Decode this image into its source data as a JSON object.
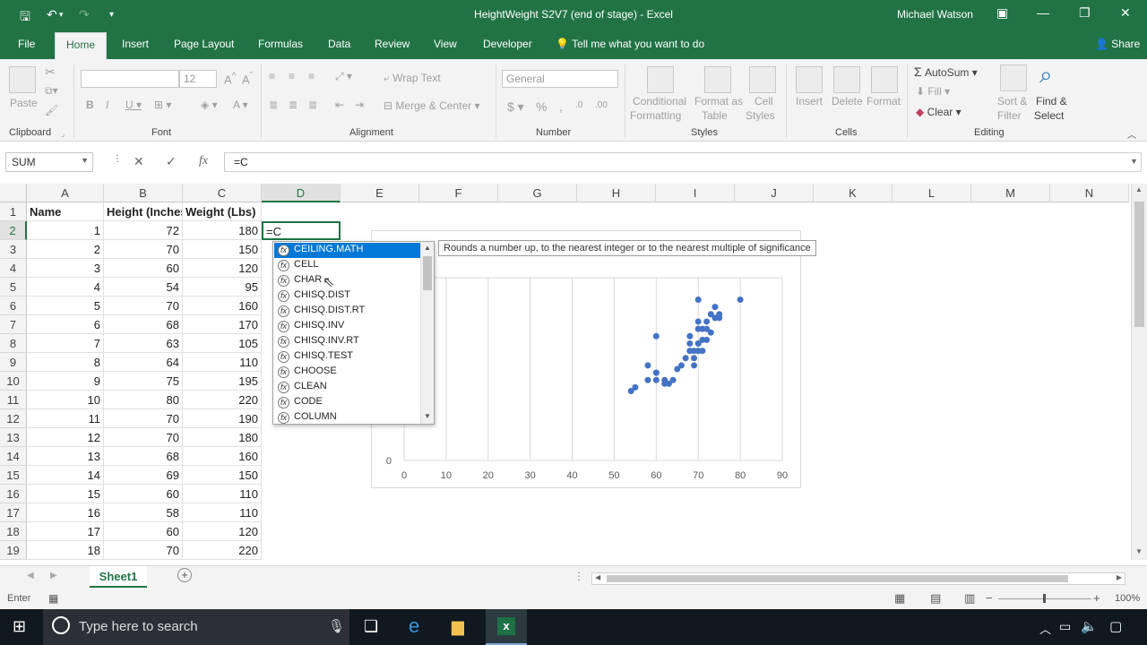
{
  "title_bar": {
    "title": "HeightWeight S2V7 (end of stage)  -  Excel",
    "user": "Michael Watson",
    "save_icon": "save-icon",
    "undo_icon": "undo-icon"
  },
  "tabs": {
    "file": "File",
    "home": "Home",
    "insert": "Insert",
    "page_layout": "Page Layout",
    "formulas": "Formulas",
    "data": "Data",
    "review": "Review",
    "view": "View",
    "developer": "Developer",
    "tell_me": "Tell me what you want to do",
    "share": "Share"
  },
  "ribbon": {
    "paste": "Paste",
    "clipboard": "Clipboard",
    "font_size": "12",
    "font": "Font",
    "wrap_text": "Wrap Text",
    "merge_center": "Merge & Center",
    "alignment": "Alignment",
    "number_format": "General",
    "number": "Number",
    "conditional_1": "Conditional",
    "conditional_2": "Formatting",
    "format_as_1": "Format as",
    "format_as_2": "Table",
    "cell_styles_1": "Cell",
    "cell_styles_2": "Styles",
    "styles": "Styles",
    "insert": "Insert",
    "delete": "Delete",
    "format": "Format",
    "cells": "Cells",
    "autosum": "AutoSum",
    "fill": "Fill",
    "clear": "Clear",
    "sort_1": "Sort &",
    "sort_2": "Filter",
    "find_1": "Find &",
    "find_2": "Select",
    "editing": "Editing"
  },
  "formula_bar": {
    "name_box": "SUM",
    "cancel": "✕",
    "enter": "✓",
    "fx": "fx",
    "formula": "=C"
  },
  "columns": [
    "A",
    "B",
    "C",
    "D",
    "E",
    "F",
    "G",
    "H",
    "I",
    "J",
    "K",
    "L",
    "M",
    "N"
  ],
  "rows": [
    "1",
    "2",
    "3",
    "4",
    "5",
    "6",
    "7",
    "8",
    "9",
    "10",
    "11",
    "12",
    "13",
    "14",
    "15",
    "16",
    "17",
    "18",
    "19"
  ],
  "headers": {
    "a": "Name",
    "b": "Height (Inches)",
    "c": "Weight (Lbs)"
  },
  "data_rows": [
    [
      "1",
      "72",
      "180"
    ],
    [
      "2",
      "70",
      "150"
    ],
    [
      "3",
      "60",
      "120"
    ],
    [
      "4",
      "54",
      "95"
    ],
    [
      "5",
      "70",
      "160"
    ],
    [
      "6",
      "68",
      "170"
    ],
    [
      "7",
      "63",
      "105"
    ],
    [
      "8",
      "64",
      "110"
    ],
    [
      "9",
      "75",
      "195"
    ],
    [
      "10",
      "80",
      "220"
    ],
    [
      "11",
      "70",
      "190"
    ],
    [
      "12",
      "70",
      "180"
    ],
    [
      "13",
      "68",
      "160"
    ],
    [
      "14",
      "69",
      "150"
    ],
    [
      "15",
      "60",
      "110"
    ],
    [
      "16",
      "58",
      "110"
    ],
    [
      "17",
      "60",
      "120"
    ],
    [
      "18",
      "70",
      "220"
    ]
  ],
  "active_cell_value": "=C",
  "autocomplete": {
    "items": [
      "CEILING.MATH",
      "CELL",
      "CHAR",
      "CHISQ.DIST",
      "CHISQ.DIST.RT",
      "CHISQ.INV",
      "CHISQ.INV.RT",
      "CHISQ.TEST",
      "CHOOSE",
      "CLEAN",
      "CODE",
      "COLUMN"
    ],
    "tooltip": "Rounds a number up, to the nearest integer or to the nearest multiple of significance"
  },
  "chart_data": {
    "type": "scatter",
    "title": "",
    "xlabel": "",
    "ylabel": "",
    "xlim": [
      0,
      90
    ],
    "x_ticks": [
      "0",
      "10",
      "20",
      "30",
      "40",
      "50",
      "60",
      "70",
      "80",
      "90"
    ],
    "y_tick_visible": "0",
    "grid": true,
    "series": [
      {
        "color": "#4472c4",
        "points": [
          [
            72,
            180
          ],
          [
            70,
            150
          ],
          [
            60,
            120
          ],
          [
            54,
            95
          ],
          [
            70,
            160
          ],
          [
            68,
            170
          ],
          [
            63,
            105
          ],
          [
            64,
            110
          ],
          [
            75,
            195
          ],
          [
            80,
            220
          ],
          [
            70,
            190
          ],
          [
            70,
            180
          ],
          [
            68,
            160
          ],
          [
            69,
            150
          ],
          [
            60,
            110
          ],
          [
            58,
            110
          ],
          [
            60,
            120
          ],
          [
            70,
            220
          ],
          [
            71,
            180
          ],
          [
            73,
            175
          ],
          [
            72,
            165
          ],
          [
            74,
            195
          ],
          [
            69,
            140
          ],
          [
            71,
            150
          ],
          [
            70,
            160
          ],
          [
            60,
            170
          ],
          [
            62,
            110
          ],
          [
            66,
            130
          ],
          [
            67,
            140
          ],
          [
            65,
            125
          ],
          [
            68,
            150
          ],
          [
            73,
            200
          ],
          [
            75,
            200
          ],
          [
            55,
            100
          ],
          [
            58,
            130
          ],
          [
            62,
            105
          ],
          [
            69,
            130
          ],
          [
            71,
            165
          ],
          [
            72,
            190
          ],
          [
            74,
            210
          ]
        ]
      }
    ]
  },
  "sheet": {
    "tab": "Sheet1"
  },
  "status": {
    "mode": "Enter",
    "zoom": "100%"
  },
  "taskbar": {
    "search_placeholder": "Type here to search"
  }
}
